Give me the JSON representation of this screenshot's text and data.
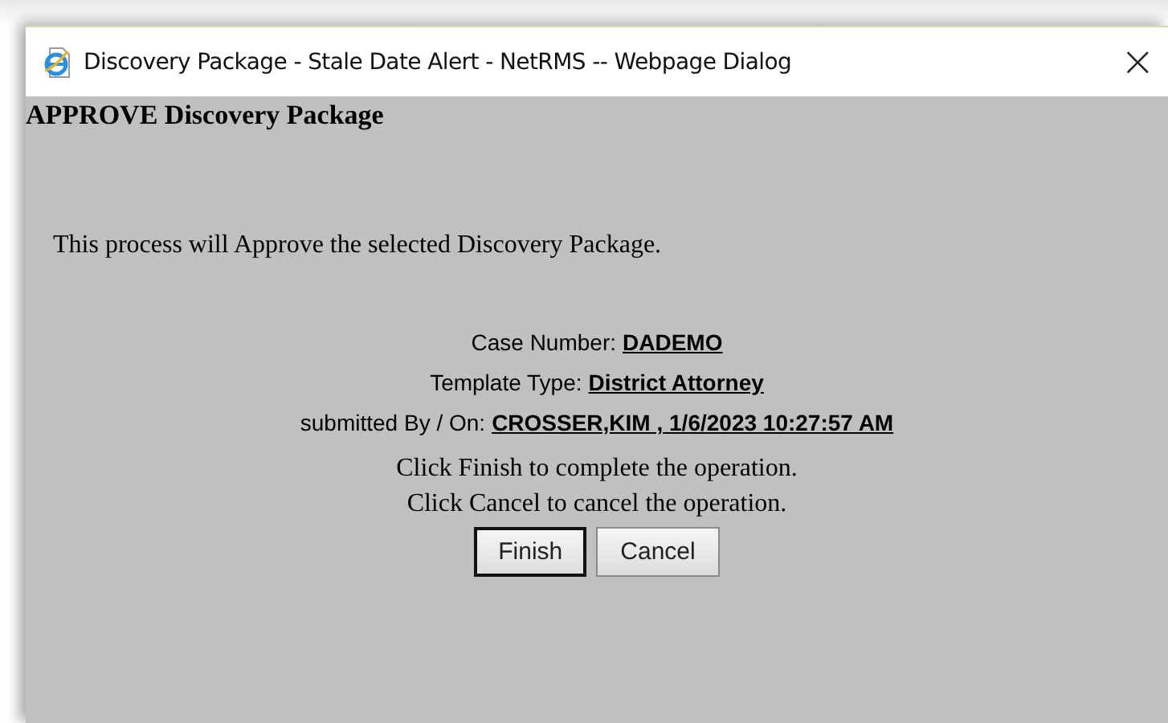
{
  "window": {
    "title": "Discovery Package - Stale Date Alert - NetRMS -- Webpage Dialog",
    "close": "×"
  },
  "heading": "APPROVE Discovery Package",
  "message": "This process will Approve the selected Discovery Package.",
  "details": [
    {
      "label": "Case Number:",
      "value": "DADEMO"
    },
    {
      "label": "Template Type:",
      "value": "District Attorney"
    },
    {
      "label": "submitted By / On:",
      "value": "CROSSER,KIM , 1/6/2023 10:27:57 AM"
    }
  ],
  "instructions": [
    "Click Finish to complete the operation.",
    "Click Cancel to cancel the operation."
  ],
  "buttons": [
    {
      "label": "Finish",
      "default": true
    },
    {
      "label": "Cancel",
      "default": false
    }
  ]
}
